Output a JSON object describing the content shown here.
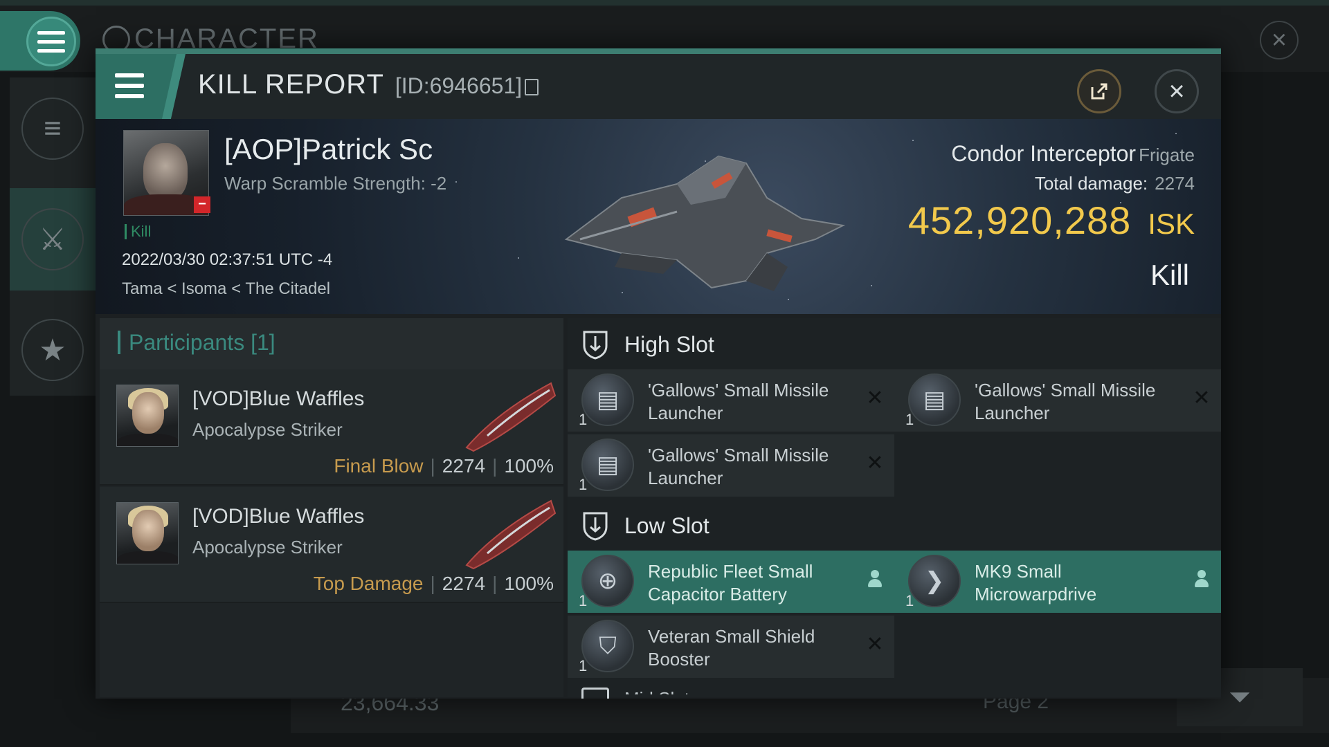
{
  "background": {
    "title": "CHARACTER",
    "close_icon": "close-icon",
    "bottom_amount": "23,664.33",
    "pager_label": "Page 2"
  },
  "header": {
    "title": "KILL REPORT",
    "id_text": "[ID:6946651]",
    "share_icon": "share-icon",
    "close_icon": "close-icon"
  },
  "victim": {
    "name": "[AOP]Patrick Sc",
    "warp_scramble": "Warp Scramble Strength: -2",
    "kill_tag": "Kill",
    "datetime": "2022/03/30 02:37:51 UTC -4",
    "location": "Tama < Isoma < The Citadel",
    "ship_name": "Condor Interceptor",
    "ship_class": "Frigate",
    "total_damage_label": "Total damage:",
    "total_damage": "2274",
    "isk_value": "452,920,288",
    "isk_unit": "ISK",
    "result": "Kill"
  },
  "participants": {
    "label": "Participants",
    "count": "[1]",
    "rows": [
      {
        "name": "[VOD]Blue Waffles",
        "ship": "Apocalypse Striker",
        "tag": "Final Blow",
        "damage": "2274",
        "percent": "100%"
      },
      {
        "name": "[VOD]Blue Waffles",
        "ship": "Apocalypse Striker",
        "tag": "Top Damage",
        "damage": "2274",
        "percent": "100%"
      }
    ]
  },
  "fitting": {
    "high_slot": {
      "label": "High Slot",
      "modules": [
        {
          "name": "'Gallows' Small Missile Launcher",
          "qty": "1",
          "status": "destroyed"
        },
        {
          "name": "'Gallows' Small Missile Launcher",
          "qty": "1",
          "status": "destroyed"
        },
        {
          "name": "'Gallows' Small Missile Launcher",
          "qty": "1",
          "status": "destroyed"
        }
      ]
    },
    "low_slot": {
      "label": "Low Slot",
      "modules": [
        {
          "name": "Republic Fleet Small Capacitor Battery",
          "qty": "1",
          "status": "dropped"
        },
        {
          "name": "MK9 Small Microwarpdrive",
          "qty": "1",
          "status": "dropped"
        },
        {
          "name": "Veteran Small Shield Booster",
          "qty": "1",
          "status": "destroyed"
        }
      ]
    },
    "mid_slot_partial": "Mid Slot"
  },
  "colors": {
    "accent": "#2d6e62",
    "isk": "#f2c94c",
    "final_blow": "#c79b4e",
    "kill_green": "#2f8b63",
    "participants_label": "#3a8a7f"
  }
}
